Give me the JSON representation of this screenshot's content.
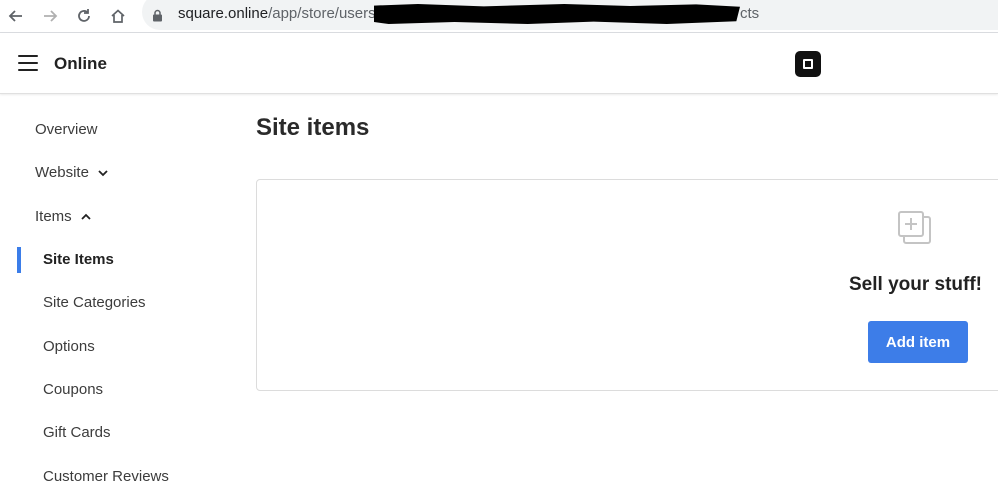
{
  "browser": {
    "url_domain": "square.online",
    "url_path": "/app/store/users",
    "url_tail": "cts"
  },
  "app": {
    "title": "Online"
  },
  "sidebar": {
    "items": [
      {
        "label": "Overview"
      },
      {
        "label": "Website"
      },
      {
        "label": "Items"
      },
      {
        "label": "Site Items"
      },
      {
        "label": "Site Categories"
      },
      {
        "label": "Options"
      },
      {
        "label": "Coupons"
      },
      {
        "label": "Gift Cards"
      },
      {
        "label": "Customer Reviews"
      }
    ]
  },
  "main": {
    "title": "Site items",
    "empty_state": {
      "title": "Sell your stuff!",
      "button_label": "Add item"
    }
  },
  "colors": {
    "accent": "#3d7de8",
    "active_indicator": "#3b7de9"
  }
}
